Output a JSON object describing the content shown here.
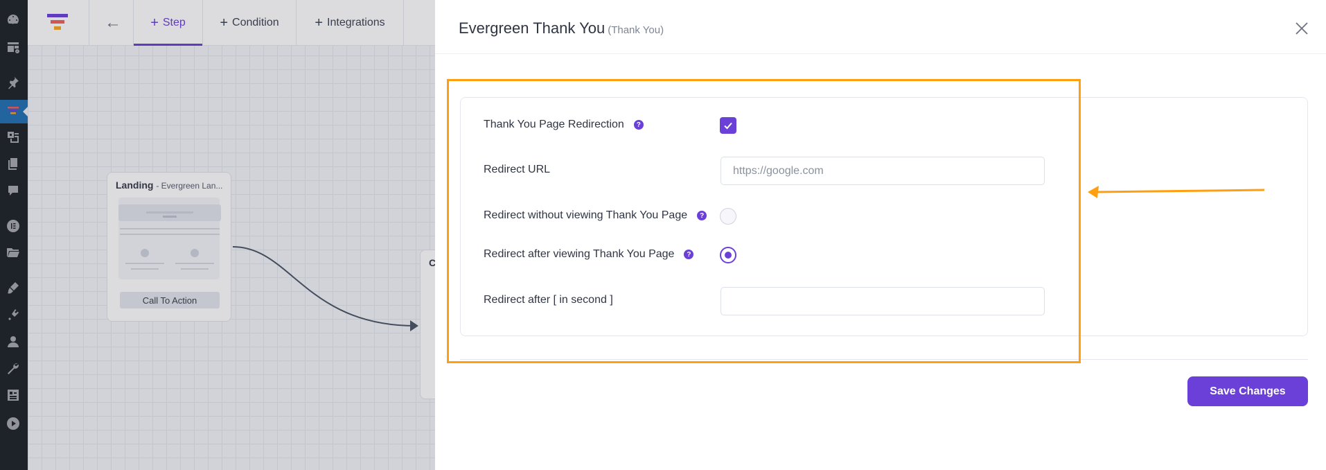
{
  "sidebar": {
    "icons": [
      "dashboard-icon",
      "updates-icon",
      "pin-icon",
      "funnel-plugin-icon",
      "media-icon",
      "pages-icon",
      "comments-icon",
      "elementor-icon",
      "folder-icon",
      "brush-icon",
      "plugin-icon",
      "user-icon",
      "tools-icon",
      "settings-icon",
      "play-icon"
    ]
  },
  "topbar": {
    "tabs": [
      {
        "label": "Step"
      },
      {
        "label": "Condition"
      },
      {
        "label": "Integrations"
      }
    ]
  },
  "canvas": {
    "node1": {
      "title": "Landing",
      "subtitle": "- Evergreen Lan...",
      "cta": "Call To Action"
    },
    "node2": {
      "title": "Ch"
    }
  },
  "panel": {
    "title": "Evergreen Thank You",
    "subtitle": "(Thank You)",
    "fields": {
      "redirection_label": "Thank You Page Redirection",
      "redirection_checked": true,
      "redirect_url_label": "Redirect URL",
      "redirect_url_placeholder": "https://google.com",
      "redirect_url_value": "",
      "without_label": "Redirect without viewing Thank You Page",
      "after_view_label": "Redirect after viewing Thank You Page",
      "after_label": "Redirect after [ in second ]",
      "after_value": ""
    },
    "help_glyph": "?",
    "save_label": "Save Changes"
  },
  "colors": {
    "accent": "#6b40d8",
    "annotation": "#ff9f10",
    "wp_sidebar": "#1d2327"
  }
}
